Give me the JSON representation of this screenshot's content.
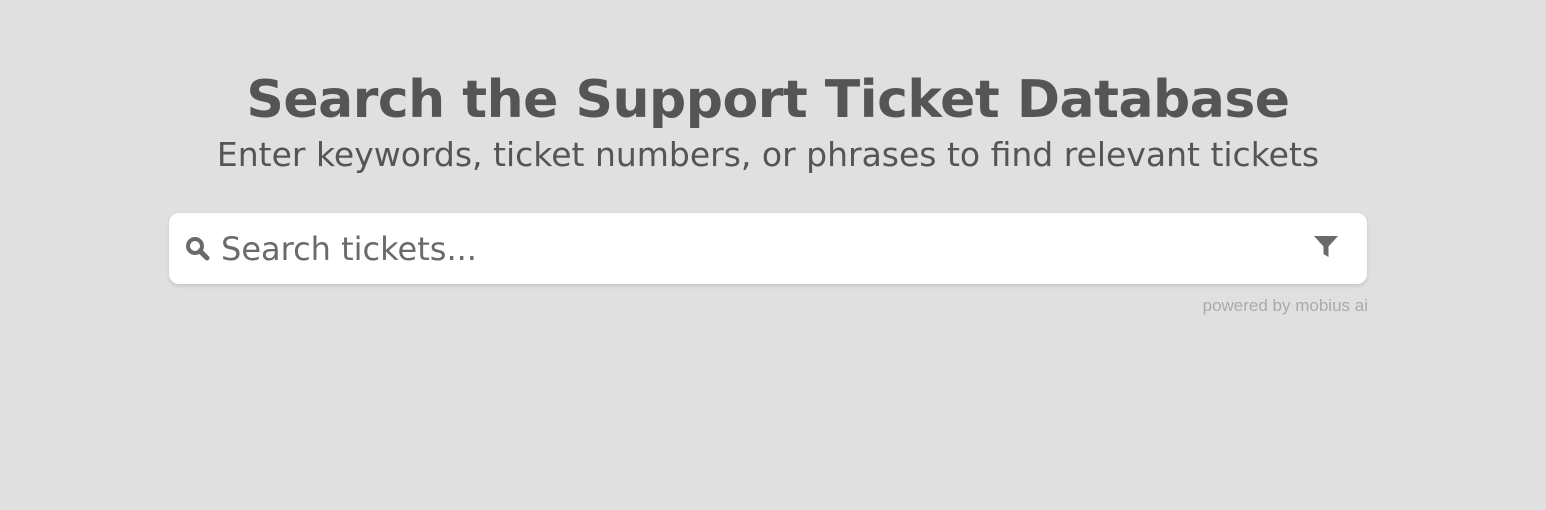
{
  "header": {
    "title": "Search the Support Ticket Database",
    "subtitle": "Enter keywords, ticket numbers, or phrases to find relevant tickets"
  },
  "search": {
    "placeholder": "Search tickets...",
    "value": "",
    "leading_icon": "search-icon",
    "trailing_icon": "filter-icon"
  },
  "footer": {
    "powered_by": "powered by mobius ai"
  },
  "colors": {
    "background": "#e0e0e0",
    "text": "#555555",
    "search_background": "#ffffff",
    "icon": "#6a6a6a",
    "muted": "#aaaaaa"
  }
}
